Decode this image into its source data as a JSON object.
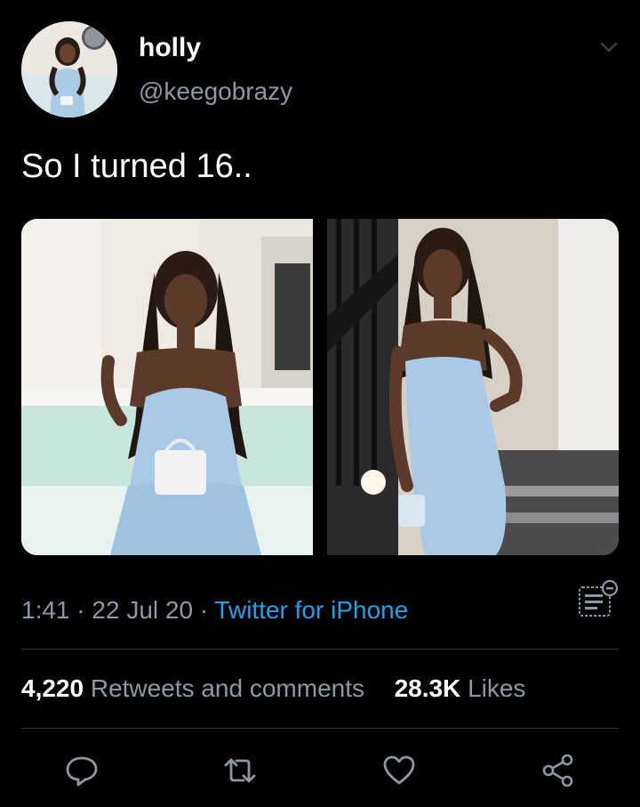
{
  "tweet": {
    "author": {
      "display_name": "holly",
      "handle": "@keegobrazy"
    },
    "text": "So I turned 16..",
    "time": "1:41",
    "date": "22 Jul 20",
    "separator": "·",
    "source": "Twitter for iPhone"
  },
  "stats": {
    "retweets_count": "4,220",
    "retweets_label": "Retweets and comments",
    "likes_count": "28.3K",
    "likes_label": "Likes"
  },
  "actions": [
    {
      "icon": "reply-icon"
    },
    {
      "icon": "retweet-icon"
    },
    {
      "icon": "like-icon"
    },
    {
      "icon": "share-icon"
    }
  ],
  "colors": {
    "background": "#000000",
    "text_primary": "#ffffff",
    "text_secondary": "#8b98a5",
    "accent": "#1da1f2",
    "divider": "#2f3336"
  }
}
